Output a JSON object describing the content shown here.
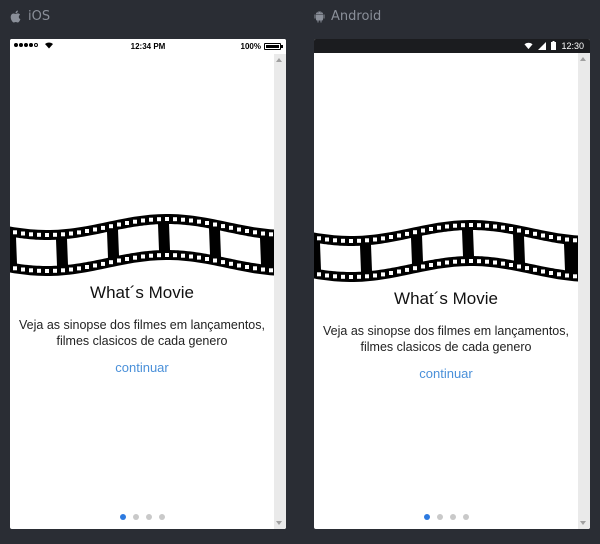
{
  "labels": {
    "ios": "iOS",
    "android": "Android"
  },
  "ios": {
    "status_time": "12:34 PM",
    "battery_pct": "100%"
  },
  "android": {
    "status_time": "12:30"
  },
  "content": {
    "title": "What´s Movie",
    "subtitle": "Veja as sinopse dos filmes em lançamentos, filmes clasicos de cada genero",
    "continue_label": "continuar"
  },
  "pagination": {
    "total": 4,
    "active_index": 0
  },
  "colors": {
    "accent": "#4a90d9",
    "dot_active": "#2d7ae0",
    "background": "#2a2d34"
  }
}
